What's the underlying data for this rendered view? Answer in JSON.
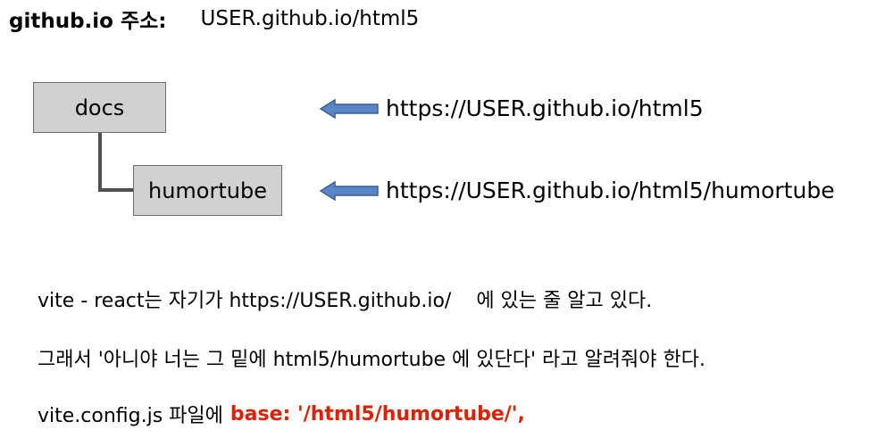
{
  "header": {
    "label": "github.io 주소:",
    "url": "USER.github.io/html5"
  },
  "tree": {
    "parent": "docs",
    "child": "humortube"
  },
  "urls": {
    "docs": "https://USER.github.io/html5",
    "humortube": "https://USER.github.io/html5/humortube"
  },
  "notes": {
    "line1_before": "vite - react는 자기가 https://USER.github.io/",
    "line1_after": "에 있는 줄 알고 있다.",
    "line2": "그래서 '아니야 너는 그 밑에 html5/humortube 에 있단다' 라고 알려줘야 한다.",
    "line3_prefix": "vite.config.js 파일에",
    "line3_highlight": "base: '/html5/humortube/',"
  },
  "colors": {
    "box_fill": "#d1d1d1",
    "box_border": "#6e6e6e",
    "arrow_fill": "#5b86c6",
    "arrow_stroke": "#3a5f96",
    "connector": "#505050",
    "highlight": "#e02000"
  },
  "icons": {
    "pointer": "left-arrow-icon"
  }
}
